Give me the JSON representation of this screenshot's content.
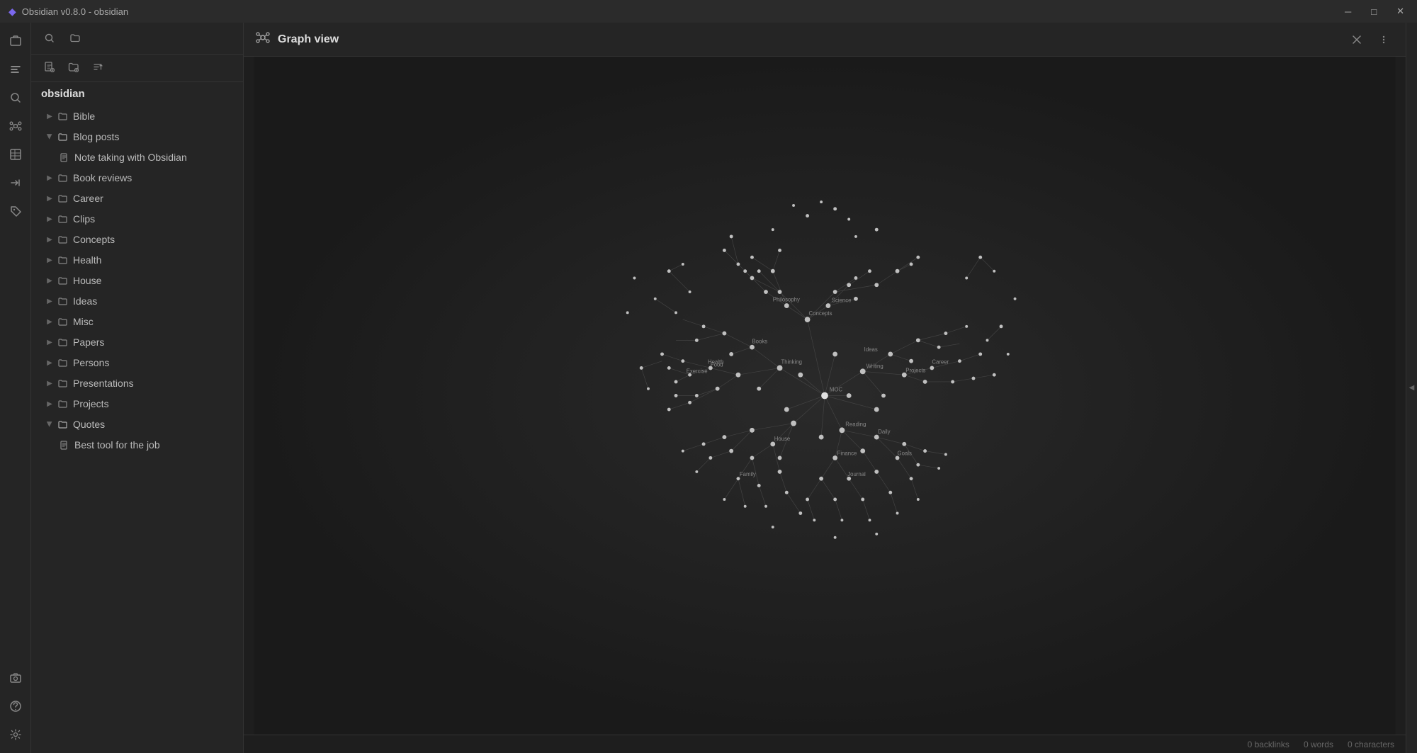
{
  "titlebar": {
    "app_name": "Obsidian v0.8.0 - obsidian",
    "icon": "◆",
    "controls": {
      "minimize": "─",
      "maximize": "□",
      "close": "✕"
    }
  },
  "ribbon": {
    "items": [
      {
        "icon": "◈",
        "name": "open-another-vault",
        "label": "Open another vault"
      },
      {
        "icon": "⊙",
        "name": "file-explorer",
        "label": "File explorer"
      },
      {
        "icon": "⌕",
        "name": "search",
        "label": "Search"
      },
      {
        "icon": "⎊",
        "name": "graph-view",
        "label": "Graph view"
      },
      {
        "icon": "⊞",
        "name": "tables",
        "label": "Tables"
      },
      {
        "icon": "☰",
        "name": "backlinks",
        "label": "Backlinks"
      },
      {
        "icon": "⊟",
        "name": "tag-pane",
        "label": "Tag pane"
      },
      {
        "icon": "⊙",
        "name": "camera",
        "label": "Camera"
      },
      {
        "icon": "?",
        "name": "help",
        "label": "Help"
      },
      {
        "icon": "⚙",
        "name": "settings",
        "label": "Settings"
      }
    ]
  },
  "sidebar": {
    "toolbar": {
      "search_icon": "⌕",
      "folder_icon": "📁"
    },
    "file_tools": {
      "new_note": "📄",
      "new_folder": "📁",
      "sort": "⇅"
    },
    "vault_name": "obsidian",
    "tree": [
      {
        "id": "bible",
        "label": "Bible",
        "collapsed": true,
        "type": "folder",
        "indent": 0
      },
      {
        "id": "blog-posts",
        "label": "Blog posts",
        "collapsed": false,
        "type": "folder",
        "indent": 0
      },
      {
        "id": "note-taking",
        "label": "Note taking with Obsidian",
        "type": "file",
        "indent": 1
      },
      {
        "id": "book-reviews",
        "label": "Book reviews",
        "collapsed": true,
        "type": "folder",
        "indent": 0
      },
      {
        "id": "career",
        "label": "Career",
        "collapsed": true,
        "type": "folder",
        "indent": 0
      },
      {
        "id": "clips",
        "label": "Clips",
        "collapsed": true,
        "type": "folder",
        "indent": 0
      },
      {
        "id": "concepts",
        "label": "Concepts",
        "collapsed": true,
        "type": "folder",
        "indent": 0
      },
      {
        "id": "health",
        "label": "Health",
        "collapsed": true,
        "type": "folder",
        "indent": 0
      },
      {
        "id": "house",
        "label": "House",
        "collapsed": true,
        "type": "folder",
        "indent": 0
      },
      {
        "id": "ideas",
        "label": "Ideas",
        "collapsed": true,
        "type": "folder",
        "indent": 0
      },
      {
        "id": "misc",
        "label": "Misc",
        "collapsed": true,
        "type": "folder",
        "indent": 0
      },
      {
        "id": "papers",
        "label": "Papers",
        "collapsed": true,
        "type": "folder",
        "indent": 0
      },
      {
        "id": "persons",
        "label": "Persons",
        "collapsed": true,
        "type": "folder",
        "indent": 0
      },
      {
        "id": "presentations",
        "label": "Presentations",
        "collapsed": true,
        "type": "folder",
        "indent": 0
      },
      {
        "id": "projects",
        "label": "Projects",
        "collapsed": true,
        "type": "folder",
        "indent": 0
      },
      {
        "id": "quotes",
        "label": "Quotes",
        "collapsed": false,
        "type": "folder",
        "indent": 0
      },
      {
        "id": "best-tool",
        "label": "Best tool for the job",
        "type": "file",
        "indent": 1
      }
    ]
  },
  "graph_view": {
    "title": "Graph view",
    "icon": "⎊",
    "close_icon": "✕",
    "more_icon": "⋮"
  },
  "status_bar": {
    "backlinks": "0 backlinks",
    "words": "0 words",
    "characters": "0 characters"
  },
  "colors": {
    "node": "#b0b0b0",
    "edge": "#555",
    "background": "#1e1e1e",
    "node_hover": "#ffffff"
  }
}
